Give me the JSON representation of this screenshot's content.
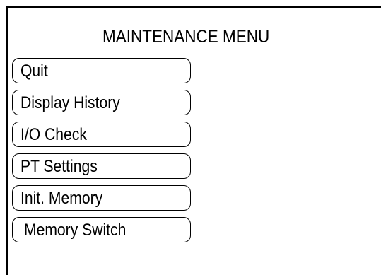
{
  "screen": {
    "title": "MAINTENANCE MENU"
  },
  "menu": {
    "items": [
      {
        "label": "Quit"
      },
      {
        "label": "Display History"
      },
      {
        "label": "I/O Check"
      },
      {
        "label": "PT Settings"
      },
      {
        "label": "Init. Memory"
      },
      {
        "label": "Memory Switch"
      }
    ]
  }
}
